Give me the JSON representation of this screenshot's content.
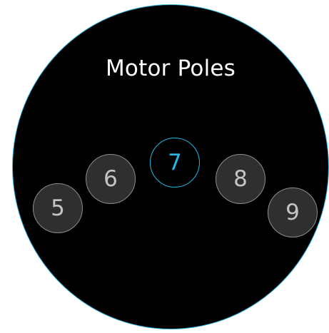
{
  "screen": {
    "title": "Motor Poles",
    "accent_color": "#23b8e6",
    "background_color": "#000000"
  },
  "poles": {
    "options": [
      "5",
      "6",
      "7",
      "8",
      "9"
    ],
    "selected": "7",
    "items": [
      {
        "label": "5",
        "selected": false
      },
      {
        "label": "6",
        "selected": false
      },
      {
        "label": "7",
        "selected": true
      },
      {
        "label": "8",
        "selected": false
      },
      {
        "label": "9",
        "selected": false
      }
    ]
  }
}
